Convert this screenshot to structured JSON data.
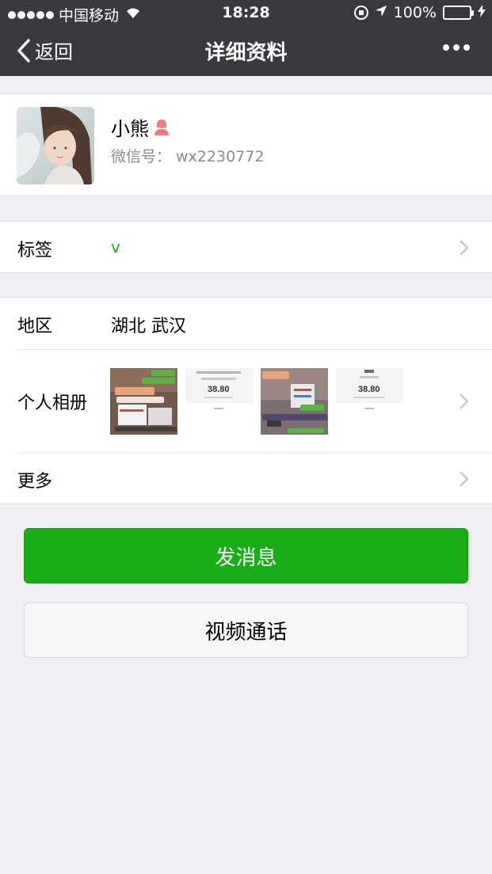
{
  "status_bar": {
    "carrier": "中国移动",
    "time": "18:28",
    "battery": "100%"
  },
  "nav": {
    "back_label": "返回",
    "title": "详细资料"
  },
  "profile": {
    "name": "小熊",
    "wechat_id": "微信号： wx2230772"
  },
  "tags": {
    "label": "标签",
    "value": "v"
  },
  "region": {
    "label": "地区",
    "value": "湖北 武汉"
  },
  "album": {
    "label": "个人相册",
    "thumbnails": [
      {
        "type": "photo-collage"
      },
      {
        "type": "red-packet-screenshot",
        "amount": "38.80"
      },
      {
        "type": "photo-collage"
      },
      {
        "type": "red-packet-screenshot",
        "amount": "38.80"
      }
    ]
  },
  "more": {
    "label": "更多"
  },
  "actions": {
    "send_message": "发消息",
    "video_call": "视频通话"
  },
  "colors": {
    "nav_bg": "#393a3f",
    "accent_green": "#1aad19",
    "page_bg": "#efeff4"
  }
}
